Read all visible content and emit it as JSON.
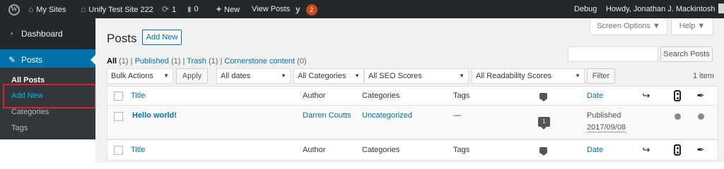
{
  "adminbar": {
    "my_sites": "My Sites",
    "site_name": "Unify Test Site 222",
    "updates_count": "1",
    "comments_count": "0",
    "new_label": "New",
    "view_posts": "View Posts",
    "yoast_badge": "2",
    "debug": "Debug",
    "howdy": "Howdy, Jonathan J. Mackintosh"
  },
  "sidebar": {
    "dashboard": "Dashboard",
    "posts": "Posts",
    "submenu": [
      "All Posts",
      "Add New",
      "Categories",
      "Tags"
    ]
  },
  "main": {
    "screen_options": "Screen Options ▼",
    "help": "Help ▼",
    "title": "Posts",
    "add_new": "Add New",
    "views": {
      "all": "All",
      "all_count": "(1)",
      "published": "Published",
      "published_count": "(1)",
      "trash": "Trash",
      "trash_count": "(1)",
      "cornerstone": "Cornerstone content",
      "cornerstone_count": "(0)",
      "sep": "|"
    },
    "search_button": "Search Posts",
    "bulk_actions": "Bulk Actions",
    "apply": "Apply",
    "all_dates": "All dates",
    "all_categories": "All Categories",
    "all_seo": "All SEO Scores",
    "all_readability": "All Readability Scores",
    "filter": "Filter",
    "item_count": "1 item"
  },
  "table": {
    "columns": [
      "Title",
      "Author",
      "Categories",
      "Tags",
      "Date"
    ],
    "row": {
      "title": "Hello world!",
      "author": "Darren Coutts",
      "category": "Uncategorized",
      "tags": "—",
      "comments": "1",
      "status": "Published",
      "date": "2017/09/08"
    }
  },
  "icons": {
    "wp_logo": "W",
    "home": "⌂",
    "refresh": "⟳",
    "comment": "▬",
    "plus": "+",
    "yoast": "y",
    "caret": "▼",
    "dashboard": "◔",
    "pin": "✎",
    "links_out": "↪",
    "feather": "✒"
  },
  "colors": {
    "adminbar_bg": "#23282d",
    "accent": "#0073aa",
    "badge": "#ca4a1f",
    "highlight_box": "#e0202a"
  }
}
